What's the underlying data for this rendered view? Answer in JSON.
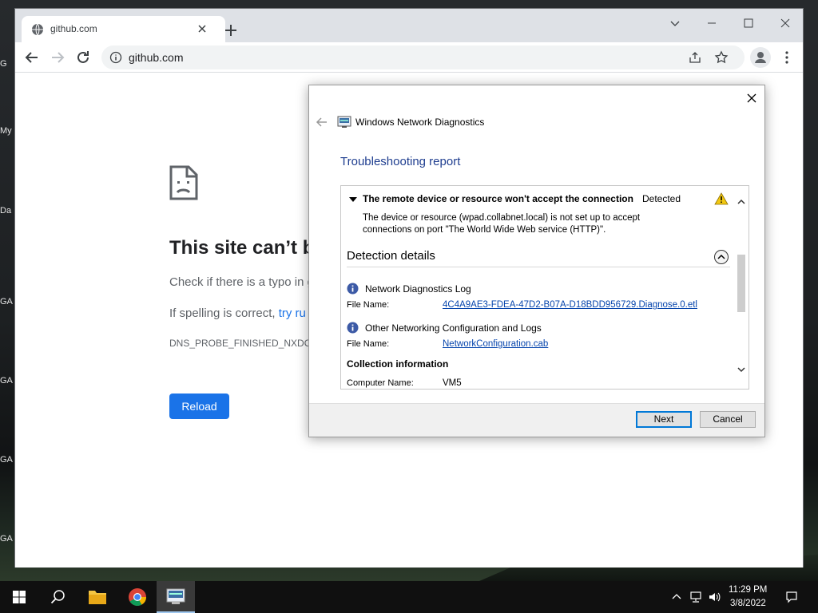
{
  "desktop": {
    "icons": [
      "G",
      "My",
      "Da",
      "GA",
      "GA",
      "GA",
      "GA"
    ]
  },
  "browser": {
    "tab": {
      "title": "github.com"
    },
    "omnibox": {
      "url": "github.com"
    }
  },
  "error_page": {
    "title": "This site can’t be",
    "typo_text": "Check if there is a typo in g",
    "spelling_prefix": "If spelling is correct, ",
    "spelling_link": "try ru",
    "error_code": "DNS_PROBE_FINISHED_NXDOMA",
    "reload_label": "Reload"
  },
  "dialog": {
    "title": "Windows Network Diagnostics",
    "heading": "Troubleshooting report",
    "issue": {
      "title": "The remote device or resource won't accept the connection",
      "status": "Detected",
      "description_line1": "The device or resource (wpad.collabnet.local) is not set up to accept",
      "description_line2": "connections on port \"The World Wide Web service (HTTP)\"."
    },
    "details_title": "Detection details",
    "log": {
      "label": "Network Diagnostics Log",
      "file_label": "File Name:",
      "file_name": "4C4A9AE3-FDEA-47D2-B07A-D18BDD956729.Diagnose.0.etl"
    },
    "other_logs": {
      "label": "Other Networking Configuration and Logs",
      "file_label": "File Name:",
      "file_name": "NetworkConfiguration.cab"
    },
    "collection": {
      "title": "Collection information",
      "computer_label": "Computer Name:",
      "computer_value": "VM5"
    },
    "buttons": {
      "next": "Next",
      "cancel": "Cancel"
    }
  },
  "taskbar": {
    "time": "11:29 PM",
    "date": "3/8/2022"
  },
  "colors": {
    "reload_button": "#1a73e8",
    "dialog_heading": "#1e3d8f",
    "link": "#0645ad",
    "warning": "#f2c811",
    "info_icon": "#3c5aa6"
  }
}
